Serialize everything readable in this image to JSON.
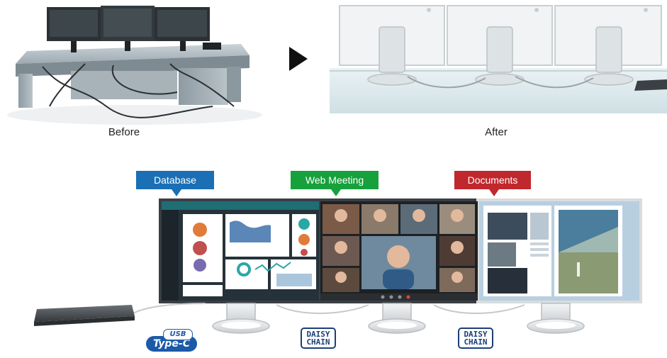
{
  "comparison": {
    "before_label": "Before",
    "after_label": "After"
  },
  "callouts": {
    "database": {
      "label": "Database",
      "color": "#1a6fb5"
    },
    "web_meeting": {
      "label": "Web Meeting",
      "color": "#17a13c"
    },
    "documents": {
      "label": "Documents",
      "color": "#c0282d"
    }
  },
  "badges": {
    "usb_top": "USB",
    "usb_bottom": "Type-C",
    "daisy_top": "DAISY",
    "daisy_bottom": "CHAIN"
  },
  "icons": [
    "arrow-right-icon",
    "usb-type-c-icon",
    "daisy-chain-icon"
  ]
}
